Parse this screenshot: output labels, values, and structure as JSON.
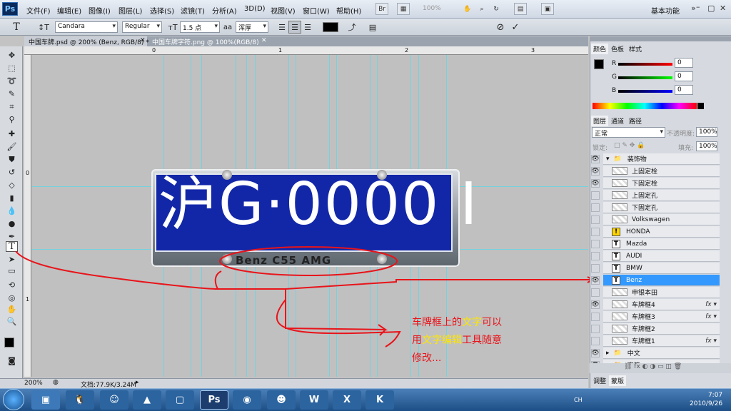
{
  "app": {
    "logo": "Ps"
  },
  "menu": [
    "文件(F)",
    "编辑(E)",
    "图像(I)",
    "图层(L)",
    "选择(S)",
    "滤镜(T)",
    "分析(A)",
    "3D(D)",
    "视图(V)",
    "窗口(W)",
    "帮助(H)"
  ],
  "topbar": {
    "zoom": "100%",
    "workspace": "基本功能"
  },
  "options": {
    "font_family": "Candara",
    "font_style": "Regular",
    "font_size": "1.5 点",
    "aa_label": "aa",
    "aa_mode": "浑厚"
  },
  "tabs": [
    {
      "label": "中国车牌.psd @ 200% (Benz, RGB/8) *"
    },
    {
      "label": "中国车牌字符.png @ 100%(RGB/8)"
    }
  ],
  "rulers": {
    "top": [
      "0",
      "1",
      "2",
      "3"
    ],
    "left": [
      "0",
      "1"
    ]
  },
  "plate": {
    "text": "沪G·0000 I",
    "brand": "Benz C55 AMG"
  },
  "status": {
    "zoom": "200%",
    "doc": "文档:77.9K/3.24M"
  },
  "panels": {
    "color_tabs": [
      "颜色",
      "色板",
      "样式"
    ],
    "rgb": [
      {
        "label": "R",
        "value": "0"
      },
      {
        "label": "G",
        "value": "0"
      },
      {
        "label": "B",
        "value": "0"
      }
    ],
    "layer_tabs": [
      "图层",
      "通道",
      "路径"
    ],
    "blend": "正常",
    "opacity_label": "不透明度:",
    "opacity": "100%",
    "lock_label": "锁定:",
    "fill_label": "填充:",
    "fill": "100%",
    "bottom_tabs": [
      "调整",
      "蒙版"
    ]
  },
  "layers": [
    {
      "name": "装饰物",
      "type": "group",
      "eye": true,
      "indent": 0
    },
    {
      "name": "上固定栓",
      "type": "raster",
      "eye": true,
      "indent": 1
    },
    {
      "name": "下固定栓",
      "type": "raster",
      "eye": true,
      "indent": 1
    },
    {
      "name": "上固定孔",
      "type": "raster",
      "eye": false,
      "indent": 1
    },
    {
      "name": "下固定孔",
      "type": "raster",
      "eye": false,
      "indent": 1
    },
    {
      "name": "Volkswagen",
      "type": "raster",
      "eye": false,
      "indent": 1
    },
    {
      "name": "HONDA",
      "type": "warn",
      "eye": false,
      "indent": 1
    },
    {
      "name": "Mazda",
      "type": "text",
      "eye": false,
      "indent": 1
    },
    {
      "name": "AUDI",
      "type": "text",
      "eye": false,
      "indent": 1
    },
    {
      "name": "BMW",
      "type": "text",
      "eye": false,
      "indent": 1
    },
    {
      "name": "Benz",
      "type": "text",
      "eye": true,
      "indent": 1,
      "selected": true
    },
    {
      "name": "申银本田",
      "type": "raster",
      "eye": false,
      "indent": 1
    },
    {
      "name": "车牌框4",
      "type": "raster",
      "eye": true,
      "indent": 1,
      "fx": true
    },
    {
      "name": "车牌框3",
      "type": "raster",
      "eye": false,
      "indent": 1,
      "fx": true
    },
    {
      "name": "车牌框2",
      "type": "raster",
      "eye": false,
      "indent": 1
    },
    {
      "name": "车牌框1",
      "type": "raster",
      "eye": false,
      "indent": 1,
      "fx": true
    },
    {
      "name": "中文",
      "type": "group",
      "eye": true,
      "indent": 0
    },
    {
      "name": "字符",
      "type": "group",
      "eye": true,
      "indent": 0
    }
  ],
  "annotation": {
    "line1_a": "车牌框上的",
    "line1_hl": "文字",
    "line1_b": "可以",
    "line2_a": "用",
    "line2_hl": "文字编辑",
    "line2_b": "工具随意",
    "line3": "修改..."
  },
  "taskbar": {
    "clock_time": "7:07",
    "clock_date": "2010/9/26",
    "lang": "CH"
  },
  "colors": {
    "accent": "#3399ff",
    "plate_blue": "#1227a8",
    "annotation": "#e8141a"
  }
}
